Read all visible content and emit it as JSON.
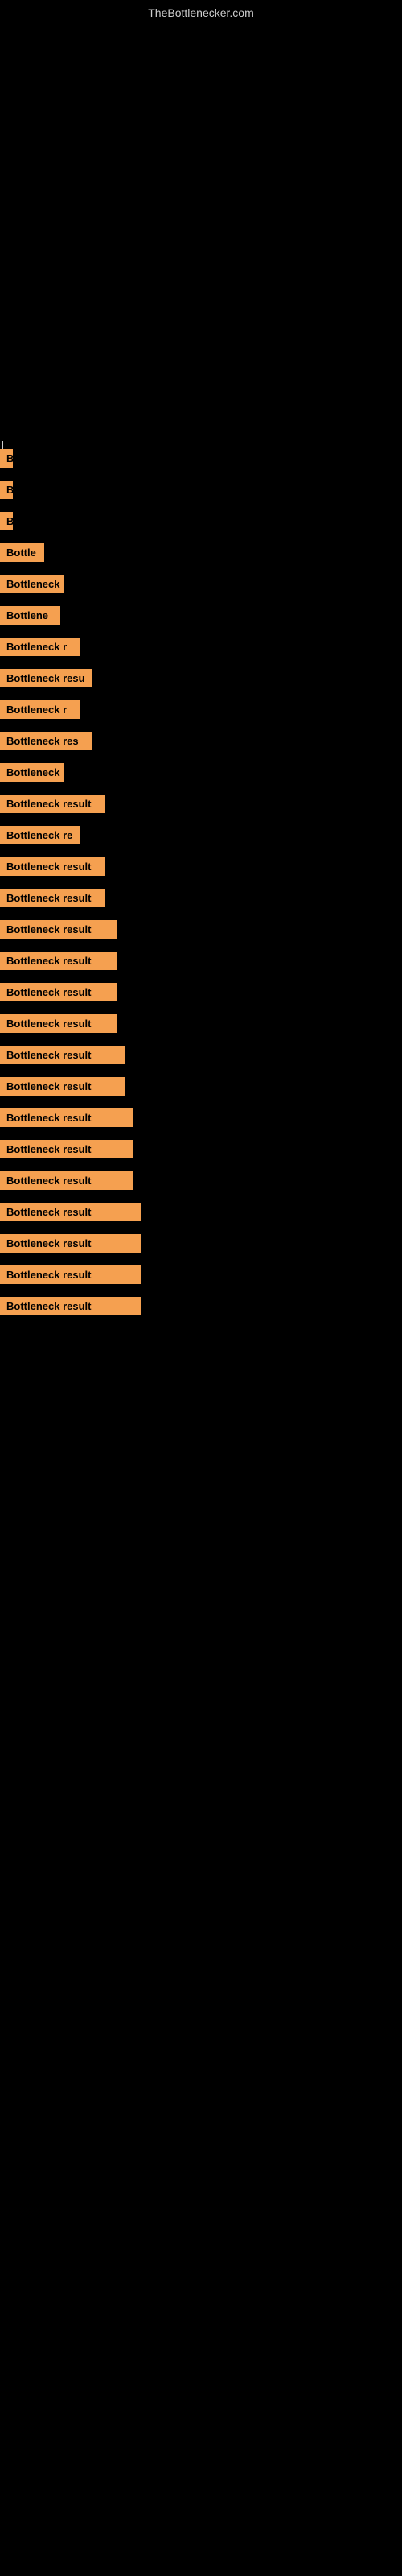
{
  "site": {
    "title": "TheBottlenecker.com"
  },
  "items": [
    {
      "id": 1,
      "label": "B",
      "width_class": "w-tiny"
    },
    {
      "id": 2,
      "label": "B",
      "width_class": "w-tiny"
    },
    {
      "id": 3,
      "label": "B",
      "width_class": "w-tiny"
    },
    {
      "id": 4,
      "label": "Bottle",
      "width_class": "w-medium"
    },
    {
      "id": 5,
      "label": "Bottleneck",
      "width_class": "w-medium-lg"
    },
    {
      "id": 6,
      "label": "Bottlene",
      "width_class": "w-large-sm"
    },
    {
      "id": 7,
      "label": "Bottleneck r",
      "width_class": "w-large"
    },
    {
      "id": 8,
      "label": "Bottleneck resu",
      "width_class": "w-large-md"
    },
    {
      "id": 9,
      "label": "Bottleneck r",
      "width_class": "w-large"
    },
    {
      "id": 10,
      "label": "Bottleneck res",
      "width_class": "w-large-md"
    },
    {
      "id": 11,
      "label": "Bottleneck",
      "width_class": "w-medium-lg"
    },
    {
      "id": 12,
      "label": "Bottleneck result",
      "width_class": "w-larger"
    },
    {
      "id": 13,
      "label": "Bottleneck re",
      "width_class": "w-large"
    },
    {
      "id": 14,
      "label": "Bottleneck result",
      "width_class": "w-larger"
    },
    {
      "id": 15,
      "label": "Bottleneck result",
      "width_class": "w-larger"
    },
    {
      "id": 16,
      "label": "Bottleneck result",
      "width_class": "w-xlarge"
    },
    {
      "id": 17,
      "label": "Bottleneck result",
      "width_class": "w-xlarge"
    },
    {
      "id": 18,
      "label": "Bottleneck result",
      "width_class": "w-xlarge"
    },
    {
      "id": 19,
      "label": "Bottleneck result",
      "width_class": "w-xlarge"
    },
    {
      "id": 20,
      "label": "Bottleneck result",
      "width_class": "w-xlarge-plus"
    },
    {
      "id": 21,
      "label": "Bottleneck result",
      "width_class": "w-xlarge-plus"
    },
    {
      "id": 22,
      "label": "Bottleneck result",
      "width_class": "w-xxlarge"
    },
    {
      "id": 23,
      "label": "Bottleneck result",
      "width_class": "w-xxlarge"
    },
    {
      "id": 24,
      "label": "Bottleneck result",
      "width_class": "w-xxlarge"
    },
    {
      "id": 25,
      "label": "Bottleneck result",
      "width_class": "w-full"
    },
    {
      "id": 26,
      "label": "Bottleneck result",
      "width_class": "w-full"
    },
    {
      "id": 27,
      "label": "Bottleneck result",
      "width_class": "w-full"
    },
    {
      "id": 28,
      "label": "Bottleneck result",
      "width_class": "w-full"
    }
  ]
}
